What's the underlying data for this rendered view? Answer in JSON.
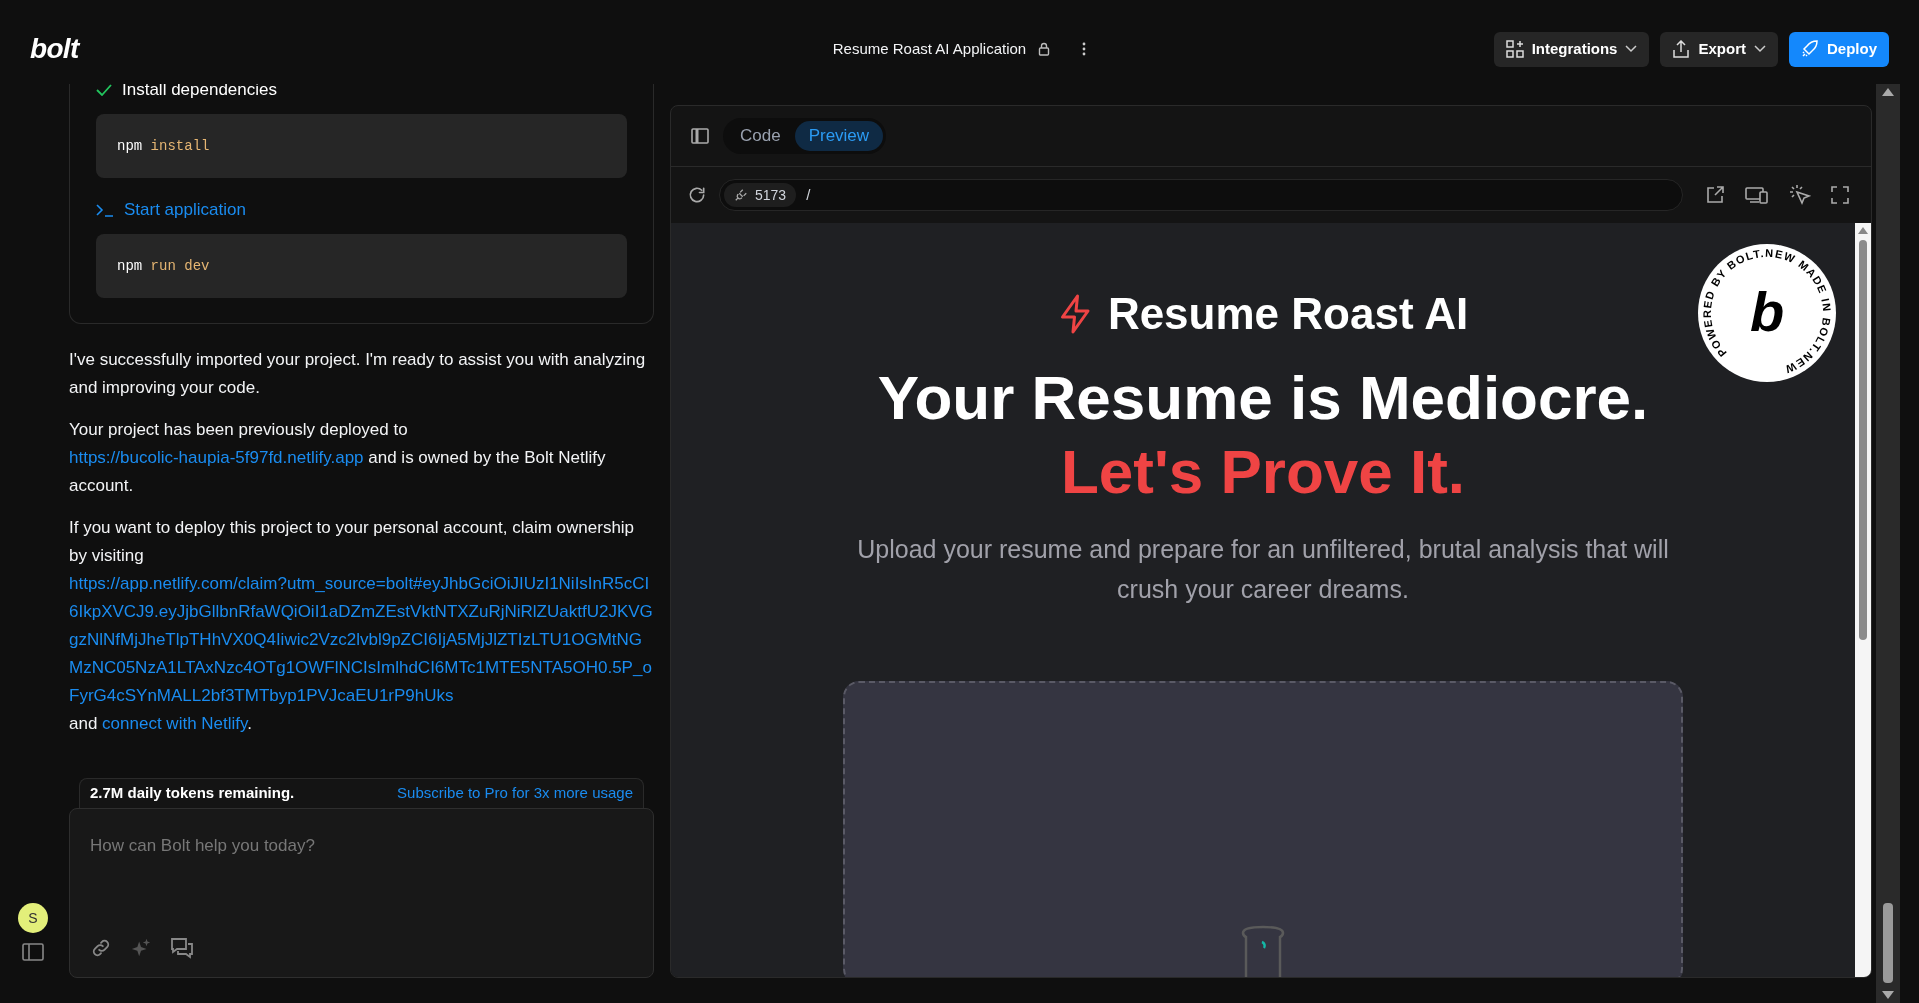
{
  "header": {
    "logo": "bolt",
    "project_title": "Resume Roast AI Application",
    "buttons": [
      {
        "label": "Integrations",
        "kind": "menu"
      },
      {
        "label": "Export",
        "kind": "menu"
      },
      {
        "label": "Deploy",
        "kind": "primary"
      }
    ]
  },
  "chat": {
    "steps": [
      {
        "label": "Install dependencies",
        "kind": "done",
        "command": [
          "npm",
          "install"
        ]
      },
      {
        "label": "Start application",
        "kind": "terminal",
        "command": [
          "npm",
          "run dev"
        ]
      }
    ],
    "paragraphs": [
      [
        {
          "text": "I've successfully imported your project. I'm ready to assist you with analyzing and improving your code.",
          "link": false
        }
      ],
      [
        {
          "text": "Your project has been previously deployed to ",
          "link": false
        },
        {
          "text": "https://bucolic-haupia-5f97fd.netlify.app",
          "link": true
        },
        {
          "text": " and is owned by the Bolt Netlify account.",
          "link": false
        }
      ],
      [
        {
          "text": "If you want to deploy this project to your personal account, claim ownership by visiting ",
          "link": false
        },
        {
          "text": "https://app.netlify.com/claim?utm_source=bolt#eyJhbGciOiJIUzI1NiIsInR5cCI6IkpXVCJ9.eyJjbGllbnRfaWQiOiI1aDZmZEstVktNTXZuRjNiRlZUaktfU2JKVGgzNlNfMjJheTlpTHhVX0Q4Iiwic2Vzc2lvbl9pZCI6IjA5MjJlZTIzLTU1OGMtNGMzNC05NzA1LTAxNzc4OTg1OWFlNCIsImlhdCI6MTc1MTE5NTA5OH0.5P_oFyrG4cSYnMALL2bf3TMTbyp1PVJcaEU1rP9hUks",
          "link": true
        },
        {
          "text": " and ",
          "link": false
        },
        {
          "text": "connect with Netlify",
          "link": true
        },
        {
          "text": ".",
          "link": false
        }
      ]
    ],
    "tokens": {
      "remaining": "2.7M daily tokens remaining.",
      "upgrade_link": "Subscribe to Pro for 3x more usage"
    },
    "input": {
      "placeholder": "How can Bolt help you today?"
    },
    "avatar": "S"
  },
  "workbench": {
    "tabs": [
      {
        "label": "Code",
        "selected": false
      },
      {
        "label": "Preview",
        "selected": true
      }
    ],
    "port": "5173",
    "path": "/"
  },
  "preview": {
    "app_name": "Resume Roast AI",
    "headline": "Your Resume is Mediocre.",
    "headline_accent": "Let's Prove It.",
    "subtitle": "Upload your resume and prepare for an unfiltered, brutal analysis that will crush your career dreams.",
    "badge_text": "POWERED BY BOLT.NEW MADE IN BOLT.NEW ",
    "badge_letter": "b"
  }
}
